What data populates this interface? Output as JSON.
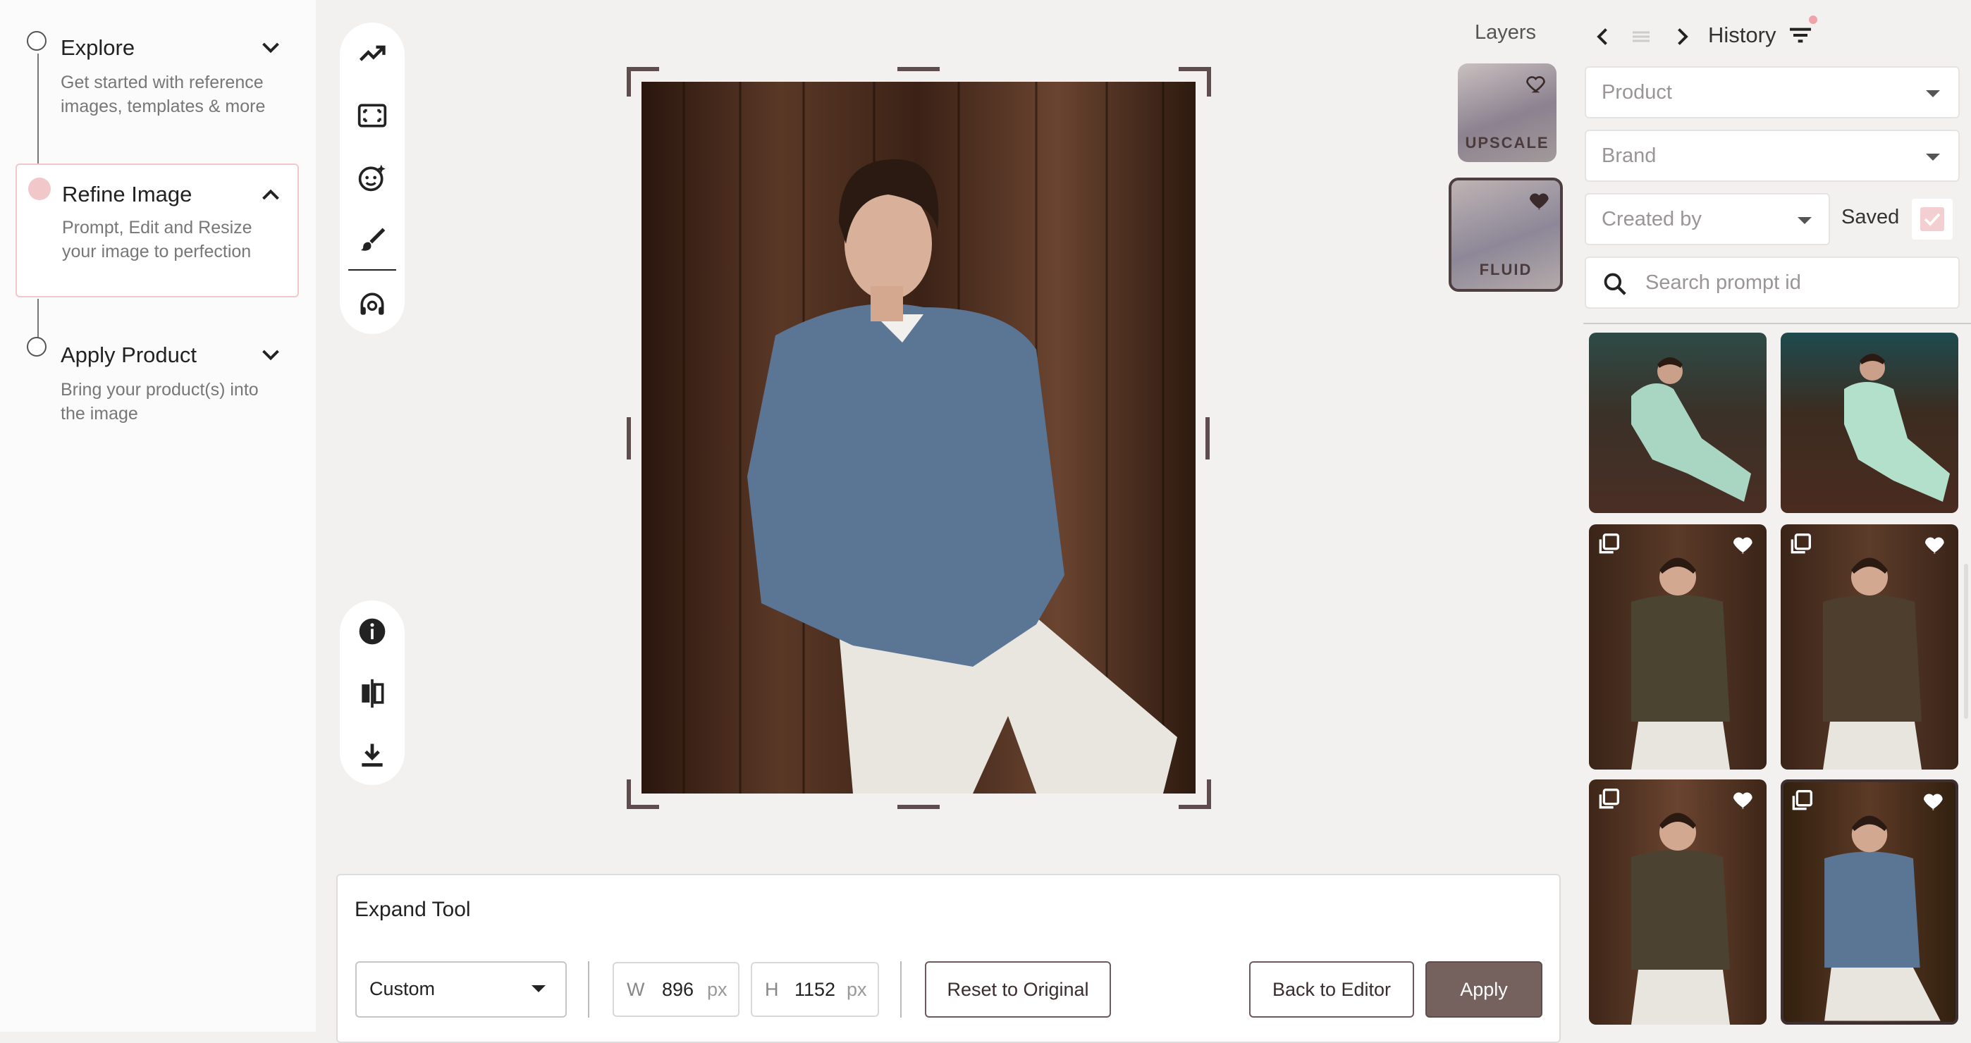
{
  "steps": [
    {
      "title": "Explore",
      "desc_line1": "Get started with reference",
      "desc_line2": "images, templates & more"
    },
    {
      "title": "Refine Image",
      "desc_line1": "Prompt, Edit and Resize",
      "desc_line2": "your image to perfection"
    },
    {
      "title": "Apply Product",
      "desc_line1": "Bring your product(s) into",
      "desc_line2": "the image"
    }
  ],
  "toolbar_top": [
    "trend-icon",
    "expand-frame-icon",
    "face-sparkle-icon",
    "brush-icon",
    "headset-icon"
  ],
  "toolbar_bottom": [
    "info-icon",
    "compare-icon",
    "download-icon"
  ],
  "layers": {
    "title": "Layers",
    "items": [
      {
        "label": "UPSCALE",
        "favorite": false
      },
      {
        "label": "FLUID",
        "favorite": true
      }
    ]
  },
  "history": {
    "title": "History",
    "filters": {
      "product_placeholder": "Product",
      "brand_placeholder": "Brand",
      "created_by_placeholder": "Created by",
      "saved_label": "Saved",
      "search_placeholder": "Search prompt id"
    },
    "thumbnails": [
      {
        "subject": "mint suit seated",
        "stack": false,
        "favorite": false
      },
      {
        "subject": "mint suit seated",
        "stack": false,
        "favorite": false
      },
      {
        "subject": "brown cardigan",
        "stack": true,
        "favorite": true
      },
      {
        "subject": "brown cardigan",
        "stack": true,
        "favorite": true
      },
      {
        "subject": "brown henley",
        "stack": true,
        "favorite": true
      },
      {
        "subject": "blue denim shirt",
        "stack": true,
        "favorite": true
      }
    ]
  },
  "expand_tool": {
    "title": "Expand Tool",
    "preset": "Custom",
    "width_label": "W",
    "width_value": "896",
    "height_label": "H",
    "height_value": "1152",
    "unit": "px",
    "reset_label": "Reset to Original",
    "back_label": "Back to Editor",
    "apply_label": "Apply"
  },
  "colors": {
    "accent": "#75625f",
    "accent_border": "#5e4c4e",
    "selected_step_dot": "#f2c7c9"
  }
}
